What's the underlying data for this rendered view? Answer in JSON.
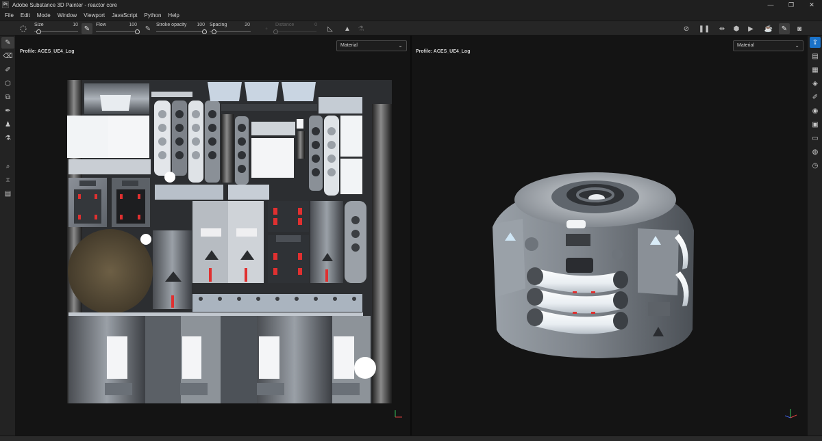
{
  "app": {
    "logo_text": "Pt",
    "title": "Adobe Substance 3D Painter - reactor core",
    "window_controls": [
      "—",
      "❐",
      "✕"
    ]
  },
  "menu": [
    "File",
    "Edit",
    "Mode",
    "Window",
    "Viewport",
    "JavaScript",
    "Python",
    "Help"
  ],
  "tool_options": {
    "size": {
      "label": "Size",
      "value": "10"
    },
    "flow": {
      "label": "Flow",
      "value": "100"
    },
    "stroke_opacity": {
      "label": "Stroke opacity",
      "value": "100"
    },
    "spacing": {
      "label": "Spacing",
      "value": "20"
    },
    "distance": {
      "label": "Distance",
      "value": "0"
    },
    "size_level": 0.1,
    "flow_level": 1.0,
    "stroke_opacity_level": 1.0,
    "spacing_level": 0.1,
    "distance_level": 0.0
  },
  "left_tools": [
    "paint-brush",
    "eraser",
    "projection",
    "polygon-fill",
    "smudge",
    "clone",
    "material-picker",
    "bake",
    "geometry-mask",
    "layer-instancer",
    "color-picker"
  ],
  "right_dock": [
    "share",
    "texture-sets",
    "texture-set-settings",
    "layers",
    "properties",
    "display-settings",
    "shader-settings",
    "assets",
    "environment",
    "history"
  ],
  "viewport_2d": {
    "profile": "Profile: ACES_UE4_Log",
    "channel": "Material"
  },
  "viewport_3d": {
    "profile": "Profile: ACES_UE4_Log",
    "channel": "Material"
  },
  "colors": {
    "accent": "#1a72c9",
    "emissive_red": "#e03030",
    "bg_viewport": "#141414"
  }
}
